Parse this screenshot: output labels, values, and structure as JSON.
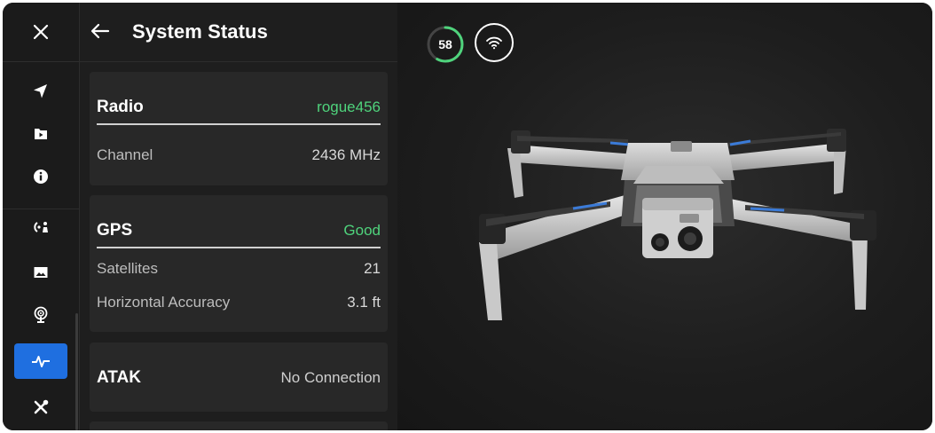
{
  "panel": {
    "title": "System Status"
  },
  "radio": {
    "title": "Radio",
    "name": "rogue456",
    "channel_label": "Channel",
    "channel_value": "2436 MHz"
  },
  "gps": {
    "title": "GPS",
    "status": "Good",
    "satellites_label": "Satellites",
    "satellites_value": "21",
    "accuracy_label": "Horizontal Accuracy",
    "accuracy_value": "3.1 ft"
  },
  "atak": {
    "title": "ATAK",
    "status": "No Connection"
  },
  "battery": {
    "level": "58",
    "fraction": 0.58
  },
  "colors": {
    "accent": "#1f6fe0",
    "good": "#4fd37c",
    "card": "#282828",
    "background": "#1a1a1a"
  },
  "rail": {
    "icons": [
      "close-icon",
      "navigate-icon",
      "media-icon",
      "info-icon",
      "pilot-icon",
      "image-icon",
      "antenna-icon",
      "pulse-icon",
      "tools-icon"
    ],
    "active": "pulse-icon"
  }
}
